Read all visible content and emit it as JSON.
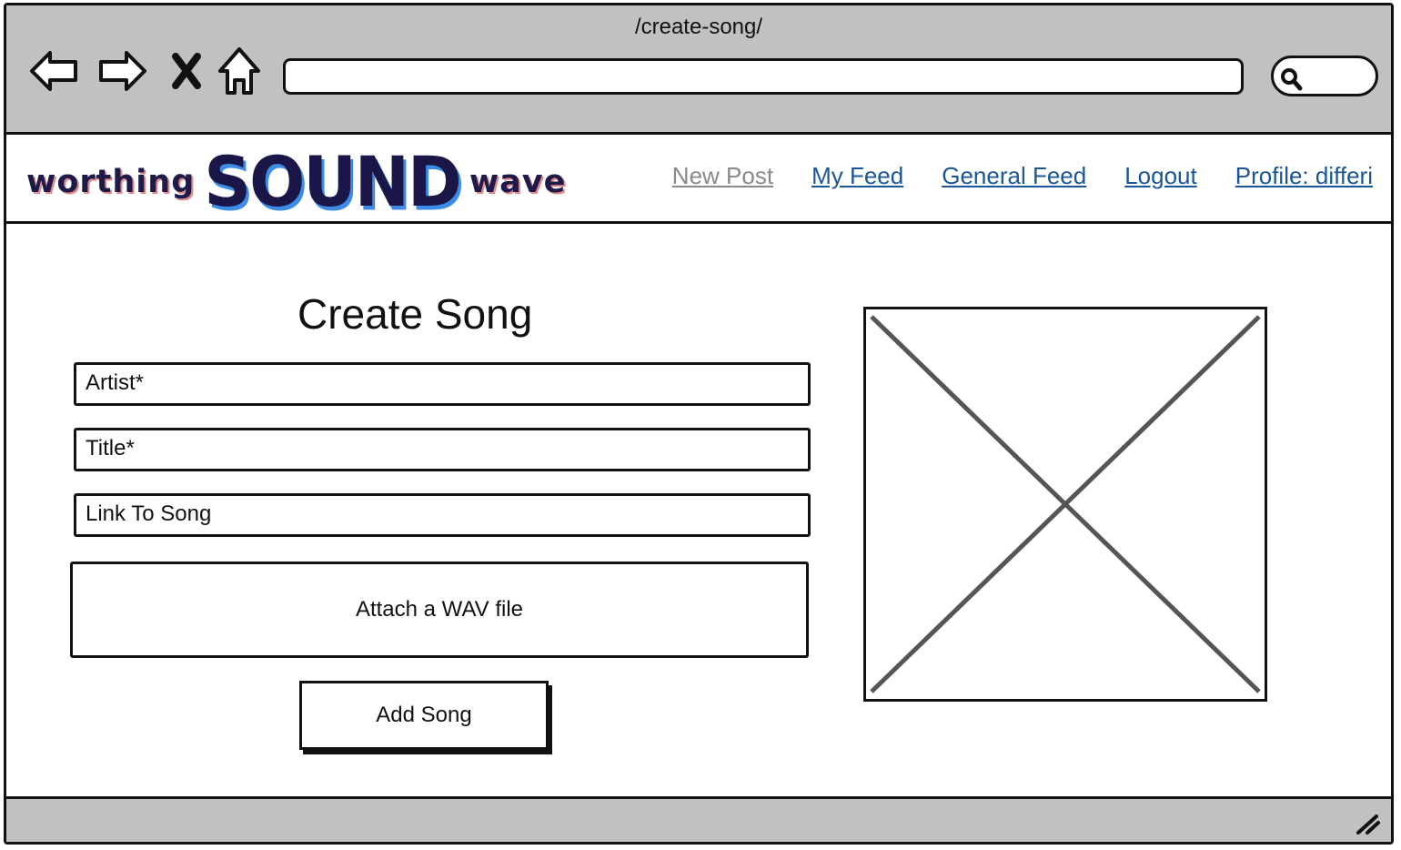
{
  "browser": {
    "url_title": "/create-song/",
    "icons": [
      "back-arrow-icon",
      "forward-arrow-icon",
      "stop-x-icon",
      "home-icon",
      "search-icon",
      "resize-grip-icon"
    ]
  },
  "header": {
    "logo": {
      "left": "worthing",
      "center": "SOUND",
      "right": "wave"
    },
    "nav": [
      {
        "label": "New Post",
        "current": true
      },
      {
        "label": "My Feed",
        "current": false
      },
      {
        "label": "General Feed",
        "current": false
      },
      {
        "label": "Logout",
        "current": false
      },
      {
        "label": "Profile: differi",
        "current": false
      }
    ],
    "colors": {
      "link": "#1b5696",
      "current_link": "#8a8a8a",
      "logo_dark": "#1a1748",
      "logo_accent": "#3c8be6"
    }
  },
  "form": {
    "title": "Create Song",
    "fields": [
      {
        "label": "Artist*"
      },
      {
        "label": "Title*"
      },
      {
        "label": "Link To Song"
      }
    ],
    "attach_label": "Attach a WAV file",
    "submit_label": "Add Song"
  }
}
